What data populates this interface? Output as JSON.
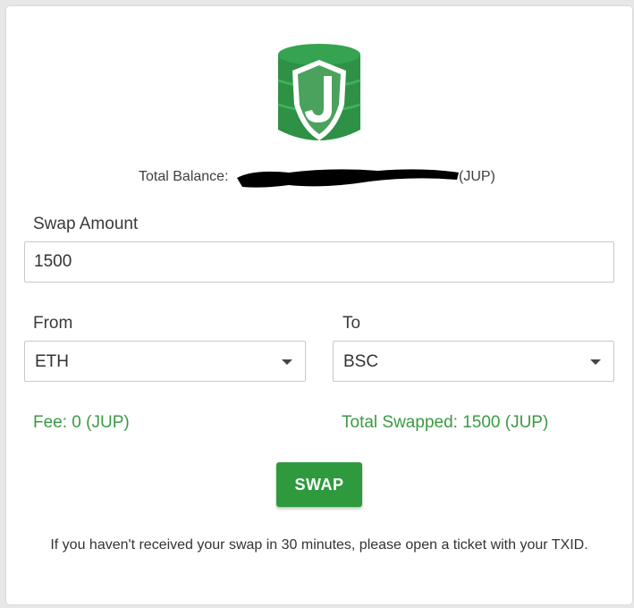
{
  "balance": {
    "label": "Total Balance:",
    "unit": "(JUP)"
  },
  "swap_amount": {
    "label": "Swap Amount",
    "value": "1500"
  },
  "from": {
    "label": "From",
    "selected": "ETH"
  },
  "to": {
    "label": "To",
    "selected": "BSC"
  },
  "fee_text": "Fee: 0 (JUP)",
  "total_swapped_text": "Total Swapped: 1500 (JUP)",
  "swap_button_label": "SWAP",
  "notice_text": "If you haven't received your swap in 30 minutes, please open a ticket with your TXID.",
  "colors": {
    "brand_green": "#2e9a3d",
    "info_green": "#3b9a44"
  }
}
